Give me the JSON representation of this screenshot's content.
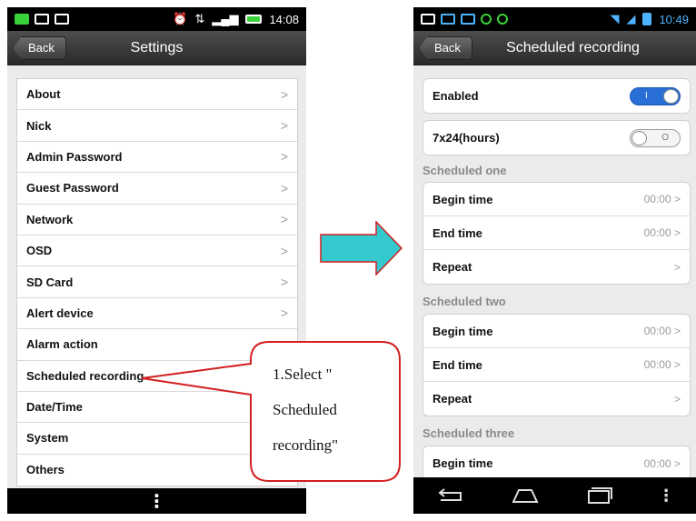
{
  "settings_screen": {
    "status_time": "14:08",
    "back_label": "Back",
    "title": "Settings",
    "items": [
      {
        "label": "About",
        "chevron": ">"
      },
      {
        "label": "Nick",
        "chevron": ">"
      },
      {
        "label": "Admin Password",
        "chevron": ">"
      },
      {
        "label": "Guest Password",
        "chevron": ">"
      },
      {
        "label": "Network",
        "chevron": ">"
      },
      {
        "label": "OSD",
        "chevron": ">"
      },
      {
        "label": "SD Card",
        "chevron": ">"
      },
      {
        "label": "Alert device",
        "chevron": ">"
      },
      {
        "label": "Alarm action",
        "chevron": ""
      },
      {
        "label": "Scheduled recording",
        "chevron": ""
      },
      {
        "label": "Date/Time",
        "chevron": ""
      },
      {
        "label": "System",
        "chevron": ""
      },
      {
        "label": "Others",
        "chevron": ""
      }
    ],
    "menu_glyph": "⋮"
  },
  "callout": {
    "line1": "1.Select      \"",
    "line2": "Scheduled",
    "line3": "recording\""
  },
  "scheduled_screen": {
    "status_time": "10:49",
    "back_label": "Back",
    "title": "Scheduled recording",
    "enabled": {
      "label": "Enabled",
      "on": true,
      "mark": "I"
    },
    "all_day": {
      "label": "7x24(hours)",
      "on": false,
      "mark": "O"
    },
    "sections": [
      {
        "title": "Scheduled one",
        "rows": [
          {
            "label": "Begin time",
            "value": "00:00 >"
          },
          {
            "label": "End time",
            "value": "00:00 >"
          },
          {
            "label": "Repeat",
            "value": ">"
          }
        ]
      },
      {
        "title": "Scheduled two",
        "rows": [
          {
            "label": "Begin time",
            "value": "00:00 >"
          },
          {
            "label": "End time",
            "value": "00:00 >"
          },
          {
            "label": "Repeat",
            "value": ">"
          }
        ]
      },
      {
        "title": "Scheduled three",
        "rows": [
          {
            "label": "Begin time",
            "value": "00:00 >"
          }
        ]
      }
    ]
  },
  "colors": {
    "arrow_fill": "#33c9cf",
    "callout_stroke": "#d21f1f",
    "toggle_on": "#2a6fd6"
  }
}
